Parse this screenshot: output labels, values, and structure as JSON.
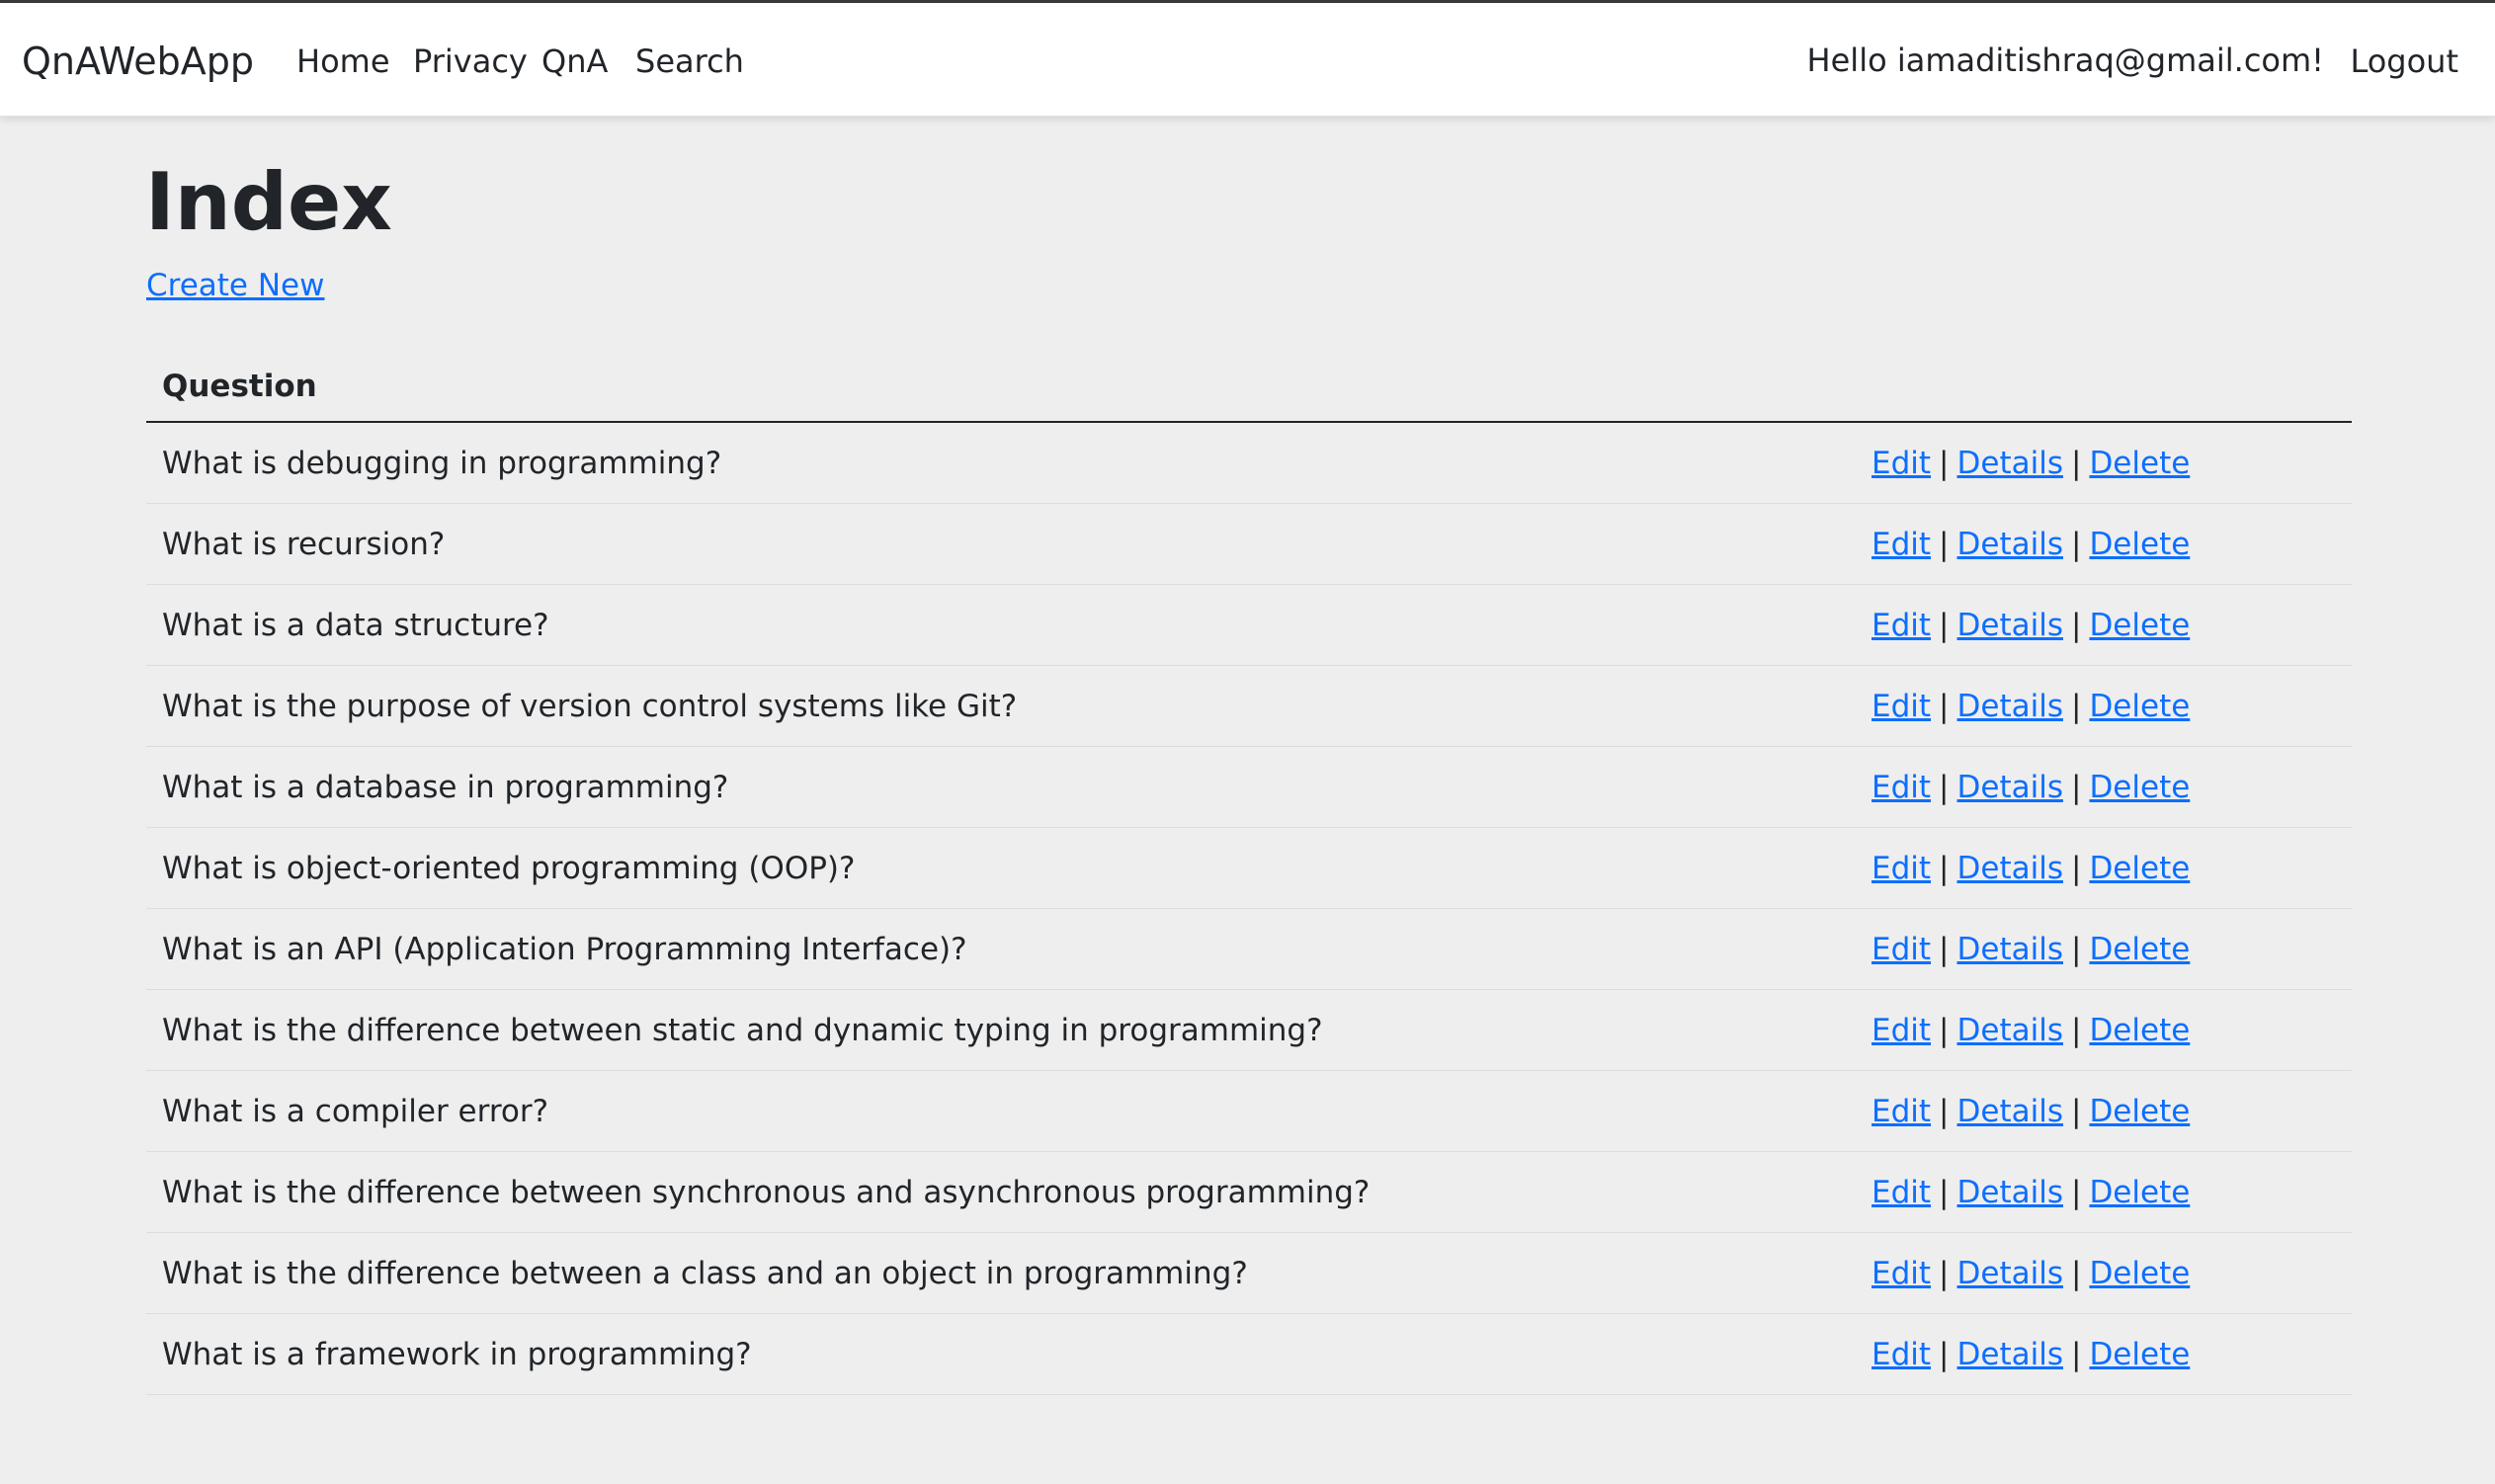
{
  "navbar": {
    "brand": "QnAWebApp",
    "links": [
      "Home",
      "Privacy",
      "QnA",
      "Search"
    ],
    "greeting": "Hello iamaditishraq@gmail.com!",
    "logout": "Logout"
  },
  "page": {
    "title": "Index",
    "create_new": "Create New"
  },
  "table": {
    "header": "Question",
    "action_labels": {
      "edit": "Edit",
      "details": "Details",
      "delete": "Delete",
      "separator": "|"
    },
    "rows": [
      "What is debugging in programming?",
      "What is recursion?",
      "What is a data structure?",
      "What is the purpose of version control systems like Git?",
      "What is a database in programming?",
      "What is object-oriented programming (OOP)?",
      "What is an API (Application Programming Interface)?",
      "What is the difference between static and dynamic typing in programming?",
      "What is a compiler error?",
      "What is the difference between synchronous and asynchronous programming?",
      "What is the difference between a class and an object in programming?",
      "What is a framework in programming?"
    ]
  },
  "colors": {
    "link": "#0d6efd",
    "background": "#eeeeee",
    "navbar_bg": "#ffffff",
    "text": "#212529"
  }
}
